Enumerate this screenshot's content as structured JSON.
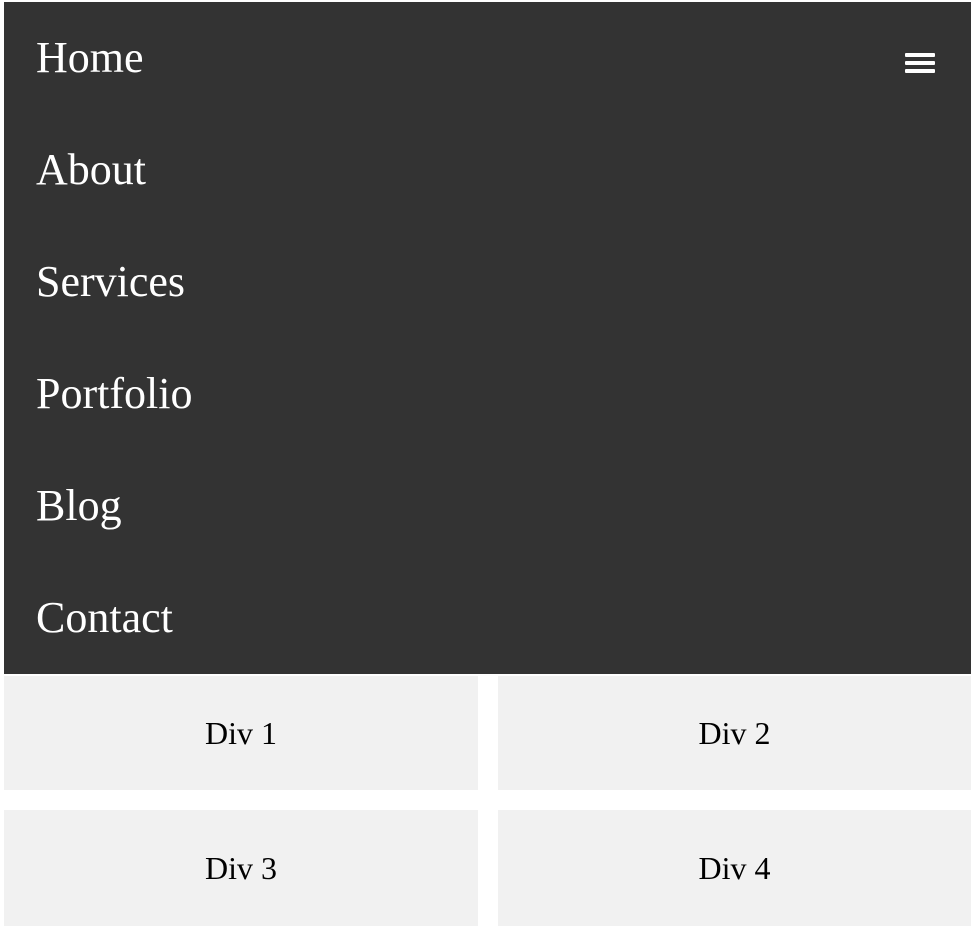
{
  "nav": {
    "items": [
      {
        "label": "Home"
      },
      {
        "label": "About"
      },
      {
        "label": "Services"
      },
      {
        "label": "Portfolio"
      },
      {
        "label": "Blog"
      },
      {
        "label": "Contact"
      }
    ],
    "toggle_icon": "hamburger-menu-icon",
    "background_color": "#333333",
    "text_color": "#ffffff"
  },
  "grid": {
    "boxes": [
      {
        "label": "Div 1"
      },
      {
        "label": "Div 2"
      },
      {
        "label": "Div 3"
      },
      {
        "label": "Div 4"
      }
    ],
    "box_color": "#f1f1f1"
  }
}
